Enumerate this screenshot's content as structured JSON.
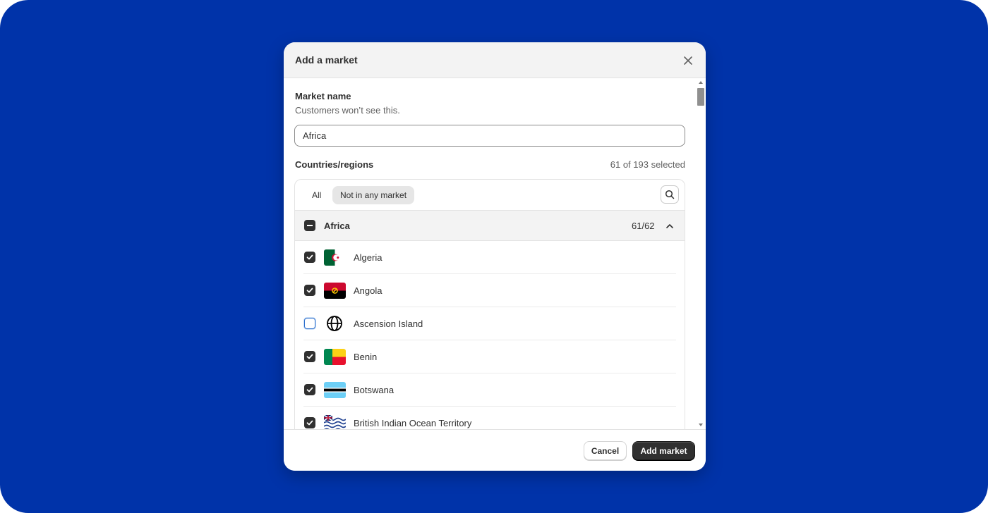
{
  "modal": {
    "title": "Add a market",
    "close_icon": "close-icon"
  },
  "market_name": {
    "label": "Market name",
    "help": "Customers won’t see this.",
    "value": "Africa"
  },
  "countries": {
    "label": "Countries/regions",
    "selected_summary": "61 of 193 selected",
    "tabs": [
      {
        "label": "All",
        "active": false
      },
      {
        "label": "Not in any market",
        "active": true
      }
    ],
    "search_icon": "search-icon",
    "group": {
      "name": "Africa",
      "count": "61/62",
      "state": "indeterminate",
      "chevron_icon": "chevron-up-icon"
    },
    "items": [
      {
        "name": "Algeria",
        "checked": true,
        "flag": "algeria-flag-icon"
      },
      {
        "name": "Angola",
        "checked": true,
        "flag": "angola-flag-icon"
      },
      {
        "name": "Ascension Island",
        "checked": false,
        "flag": "globe-icon"
      },
      {
        "name": "Benin",
        "checked": true,
        "flag": "benin-flag-icon"
      },
      {
        "name": "Botswana",
        "checked": true,
        "flag": "botswana-flag-icon"
      },
      {
        "name": "British Indian Ocean Territory",
        "checked": true,
        "flag": "british-indian-ocean-territory-flag-icon"
      }
    ]
  },
  "footer": {
    "cancel_label": "Cancel",
    "submit_label": "Add market"
  },
  "colors": {
    "backdrop": "#0033a9",
    "primary_button": "#303030",
    "focus_ring": "#2c6ecb"
  }
}
